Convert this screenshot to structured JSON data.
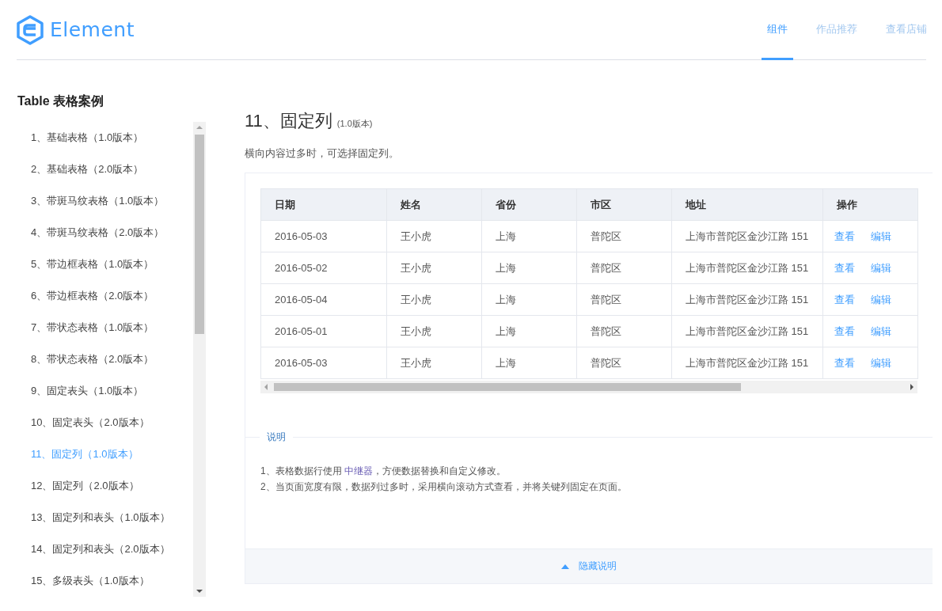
{
  "header": {
    "logo_text": "Element",
    "nav": [
      {
        "label": "组件",
        "selected": true
      },
      {
        "label": "作品推荐",
        "selected": false
      },
      {
        "label": "查看店铺",
        "selected": false
      }
    ]
  },
  "sidebar": {
    "title": "Table 表格案例",
    "items": [
      {
        "label": "1、基础表格（1.0版本）",
        "selected": false
      },
      {
        "label": "2、基础表格（2.0版本）",
        "selected": false
      },
      {
        "label": "3、带斑马纹表格（1.0版本）",
        "selected": false
      },
      {
        "label": "4、带斑马纹表格（2.0版本）",
        "selected": false
      },
      {
        "label": "5、带边框表格（1.0版本）",
        "selected": false
      },
      {
        "label": "6、带边框表格（2.0版本）",
        "selected": false
      },
      {
        "label": "7、带状态表格（1.0版本）",
        "selected": false
      },
      {
        "label": "8、带状态表格（2.0版本）",
        "selected": false
      },
      {
        "label": "9、固定表头（1.0版本）",
        "selected": false
      },
      {
        "label": "10、固定表头（2.0版本）",
        "selected": false
      },
      {
        "label": "11、固定列（1.0版本）",
        "selected": true
      },
      {
        "label": "12、固定列（2.0版本）",
        "selected": false
      },
      {
        "label": "13、固定列和表头（1.0版本）",
        "selected": false
      },
      {
        "label": "14、固定列和表头（2.0版本）",
        "selected": false
      },
      {
        "label": "15、多级表头（1.0版本）",
        "selected": false
      }
    ]
  },
  "section": {
    "title": "11、固定列",
    "version": "(1.0版本)",
    "description": "横向内容过多时，可选择固定列。",
    "table": {
      "columns": [
        "日期",
        "姓名",
        "省份",
        "市区",
        "地址",
        "操作"
      ],
      "rows": [
        {
          "cells": [
            "2016-05-03",
            "王小虎",
            "上海",
            "普陀区",
            "上海市普陀区金沙江路 151"
          ],
          "actions": [
            "查看",
            "编辑"
          ]
        },
        {
          "cells": [
            "2016-05-02",
            "王小虎",
            "上海",
            "普陀区",
            "上海市普陀区金沙江路 151"
          ],
          "actions": [
            "查看",
            "编辑"
          ]
        },
        {
          "cells": [
            "2016-05-04",
            "王小虎",
            "上海",
            "普陀区",
            "上海市普陀区金沙江路 151"
          ],
          "actions": [
            "查看",
            "编辑"
          ]
        },
        {
          "cells": [
            "2016-05-01",
            "王小虎",
            "上海",
            "普陀区",
            "上海市普陀区金沙江路 151"
          ],
          "actions": [
            "查看",
            "编辑"
          ]
        },
        {
          "cells": [
            "2016-05-03",
            "王小虎",
            "上海",
            "普陀区",
            "上海市普陀区金沙江路 151"
          ],
          "actions": [
            "查看",
            "编辑"
          ]
        }
      ]
    },
    "notes": {
      "legend": "说明",
      "lines": [
        {
          "before": "1、表格数据行使用 ",
          "link": "中继器",
          "after": "，方便数据替换和自定义修改。"
        },
        {
          "before": "2、当页面宽度有限，数据列过多时，采用横向滚动方式查看，并将关键列固定在页面。"
        }
      ]
    },
    "toggle": "隐藏说明"
  }
}
